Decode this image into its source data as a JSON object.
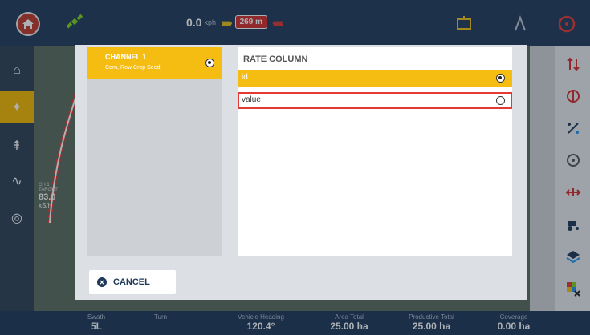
{
  "topbar": {
    "speed_value": "0.0",
    "speed_unit": "kph",
    "distance": "269 m"
  },
  "map_overlay": {
    "channel_tag": "CH 1",
    "target_label": "TARGET",
    "target_value": "83.0",
    "target_unit": "kS/h"
  },
  "dialog": {
    "channels": [
      {
        "title": "CHANNEL 1",
        "subtitle": "Corn, Row Crop Seed",
        "selected": true
      }
    ],
    "rate_column": {
      "title": "RATE COLUMN",
      "options": [
        {
          "label": "id",
          "selected": true
        },
        {
          "label": "value",
          "selected": false
        }
      ]
    },
    "cancel_label": "CANCEL"
  },
  "statusbar": {
    "items": [
      {
        "label": "Swath",
        "value": "5L"
      },
      {
        "label": "Turn",
        "value": ""
      },
      {
        "label": "Vehicle Heading",
        "value": "120.4°"
      },
      {
        "label": "Area Total",
        "value": "25.00 ha"
      },
      {
        "label": "Productive Total",
        "value": "25.00 ha"
      },
      {
        "label": "Coverage",
        "value": "0.00 ha"
      }
    ]
  },
  "colors": {
    "accent": "#f5bd12",
    "topbar": "#243d5c",
    "highlight": "#e53935"
  }
}
